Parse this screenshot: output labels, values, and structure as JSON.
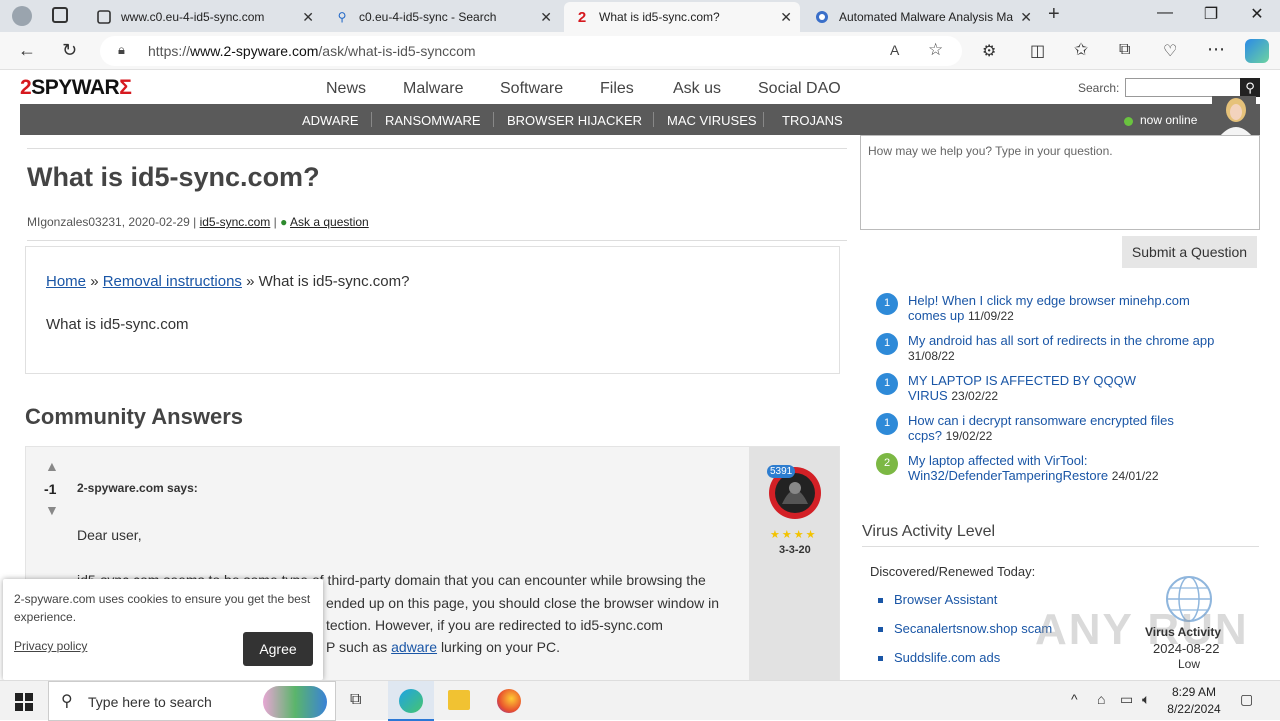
{
  "browser": {
    "tabs": [
      {
        "title": "www.c0.eu-4-id5-sync.com"
      },
      {
        "title": "c0.eu-4-id5-sync - Search"
      },
      {
        "title": "What is id5-sync.com?"
      },
      {
        "title": "Automated Malware Analysis Ma"
      }
    ],
    "url_prefix": "https://",
    "url_domain": "www.2-spyware.com",
    "url_path": "/ask/what-is-id5-synccom"
  },
  "site": {
    "logo_a": "2",
    "logo_b": "SPYWAR",
    "logo_c": "Σ",
    "nav": [
      "News",
      "Malware",
      "Software",
      "Files",
      "Ask us",
      "Social DAO"
    ],
    "search_label": "Search:",
    "subnav": [
      "ADWARE",
      "RANSOMWARE",
      "BROWSER HIJACKER",
      "MAC VIRUSES",
      "TROJANS"
    ],
    "online": "now online",
    "chat_placeholder": "How may we help you? Type in your question.",
    "submit_label": "Submit a Question"
  },
  "article": {
    "title": "What is id5-sync.com?",
    "author_date": "MIgonzales03231, 2020-02-29 |",
    "tag": "id5-sync.com",
    "sep": "|",
    "ask": "Ask a question",
    "crumb_home": "Home",
    "crumb_sep1": "»",
    "crumb_removal": "Removal instructions",
    "crumb_current": "» What is id5-sync.com?",
    "question": "What is id5-sync.com"
  },
  "answers": {
    "title": "Community Answers",
    "score": "-1",
    "author": "2-spyware.com says:",
    "greeting": "Dear user,",
    "line1": "id5-sync.com seems to be some type of third-party domain that you can encounter while browsing the",
    "line2": "ended up on this page, you should close the browser window in",
    "line3": "tection. However, if you are redirected to id5-sync.com",
    "line4_a": "P such as",
    "line4_link": "adware",
    "line4_b": "lurking on your PC.",
    "badge": "5391",
    "stars": "★★★★",
    "date": "3-3-20"
  },
  "questions": [
    {
      "count": "1",
      "text": "Help! When I click my edge browser minehp.com comes up",
      "date": "11/09/22",
      "color": "#2e8ad8"
    },
    {
      "count": "1",
      "text": "My android has all sort of redirects in the chrome app",
      "date": "31/08/22",
      "color": "#2e8ad8"
    },
    {
      "count": "1",
      "text": "MY LAPTOP IS AFFECTED BY QQQW VIRUS",
      "date": "23/02/22",
      "color": "#2e8ad8"
    },
    {
      "count": "1",
      "text": "How can i decrypt ransomware encrypted files ccps?",
      "date": "19/02/22",
      "color": "#2e8ad8"
    },
    {
      "count": "2",
      "text": "My laptop affected with VirTool: Win32/DefenderTamperingRestore",
      "date": "24/01/22",
      "color": "#7cb844"
    }
  ],
  "virus_activity": {
    "title": "Virus Activity Level",
    "discovered": "Discovered/Renewed Today:",
    "items": [
      "Browser Assistant",
      "Secanalertsnow.shop scam",
      "Suddslife.com ads"
    ],
    "widget_title": "Virus Activity",
    "widget_date": "2024-08-22",
    "widget_level": "Low"
  },
  "watermark": "ANY RUN",
  "cookie": {
    "text": "2-spyware.com uses cookies to ensure you get the best experience.",
    "privacy": "Privacy policy",
    "agree": "Agree"
  },
  "taskbar": {
    "search_placeholder": "Type here to search",
    "time": "8:29 AM",
    "date": "8/22/2024"
  }
}
